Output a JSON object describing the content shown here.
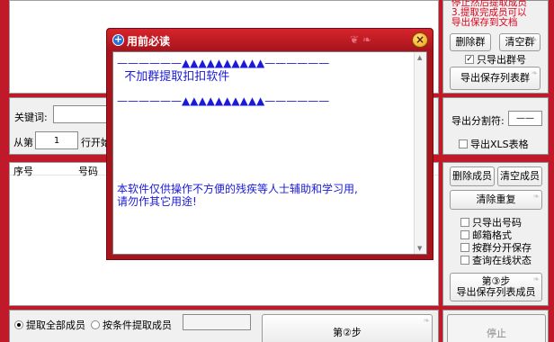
{
  "top_right_notes": [
    "停止然后提取成员",
    "3.提取完成员可以",
    "导出保存到文档"
  ],
  "group_buttons": {
    "delete_group": "删除群",
    "clear_group": "清空群",
    "export_group_number": "只导出群号",
    "export_group_list": "导出保存列表群"
  },
  "keyword": {
    "label": "关键词:",
    "value": ""
  },
  "start_from": {
    "label_before": "从第",
    "value": "1",
    "label_after": "行开始"
  },
  "separator": {
    "label": "导出分割符:",
    "value": "——"
  },
  "export_xls": "导出XLS表格",
  "table": {
    "headers": [
      "序号",
      "号码"
    ]
  },
  "member_buttons": {
    "delete_member": "删除成员",
    "clear_member": "清空成员",
    "clear_duplicates": "清除重复"
  },
  "member_options": [
    "只导出号码",
    "邮箱格式",
    "按群分开保存",
    "查询在线状态"
  ],
  "step3_button": [
    "第③步",
    "导出保存列表成员"
  ],
  "extract_options": {
    "all_members": "提取全部成员",
    "conditional": "按条件提取成员",
    "all_selected": true
  },
  "step2_button": "第②步",
  "stop_button": "停止",
  "dialog": {
    "title": "用前必读",
    "line1": "——————▲▲▲▲▲▲▲▲▲▲——————",
    "line2": "  不加群提取扣扣软件",
    "line3": "——————▲▲▲▲▲▲▲▲▲▲——————",
    "line4": "本软件仅供操作不方便的残疾等人士辅助和学习用,",
    "line5": "请勿作其它用途!"
  },
  "colors": {
    "background": "#c0192a",
    "dialog_text": "#1a1ad8",
    "notice_text": "#e0001a"
  }
}
